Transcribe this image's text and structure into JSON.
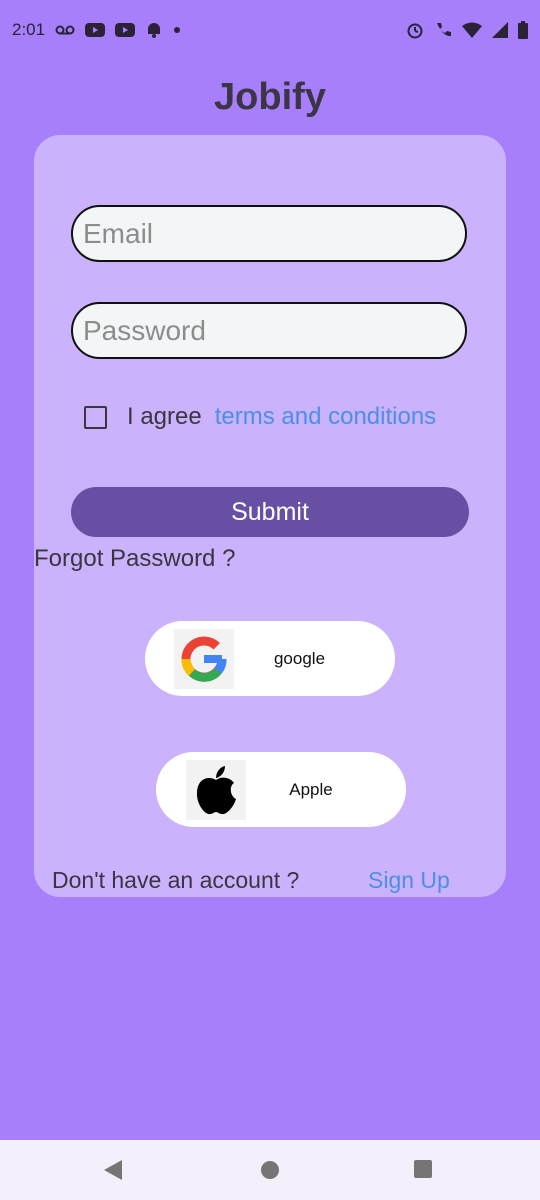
{
  "status_bar": {
    "time": "2:01",
    "left_icons": [
      "voicemail-icon",
      "youtube-icon",
      "youtube-icon",
      "notification-icon",
      "dot-icon"
    ],
    "right_icons": [
      "alarm-icon",
      "wifi-calling-icon",
      "wifi-icon",
      "signal-icon",
      "battery-icon"
    ]
  },
  "app": {
    "title": "Jobify"
  },
  "form": {
    "email_placeholder": "Email",
    "password_placeholder": "Password",
    "agree_text": "I agree",
    "terms_link": "terms and conditions",
    "submit_label": "Submit",
    "forgot_password": "Forgot Password ?"
  },
  "social": {
    "google_label": "google",
    "apple_label": "Apple"
  },
  "signup": {
    "prompt": "Don't have an account ?",
    "link": "Sign Up"
  },
  "colors": {
    "background": "#a77ffb",
    "card": "#cbb2fd",
    "primary_button": "#6750a4",
    "link": "#4c8fe8"
  }
}
